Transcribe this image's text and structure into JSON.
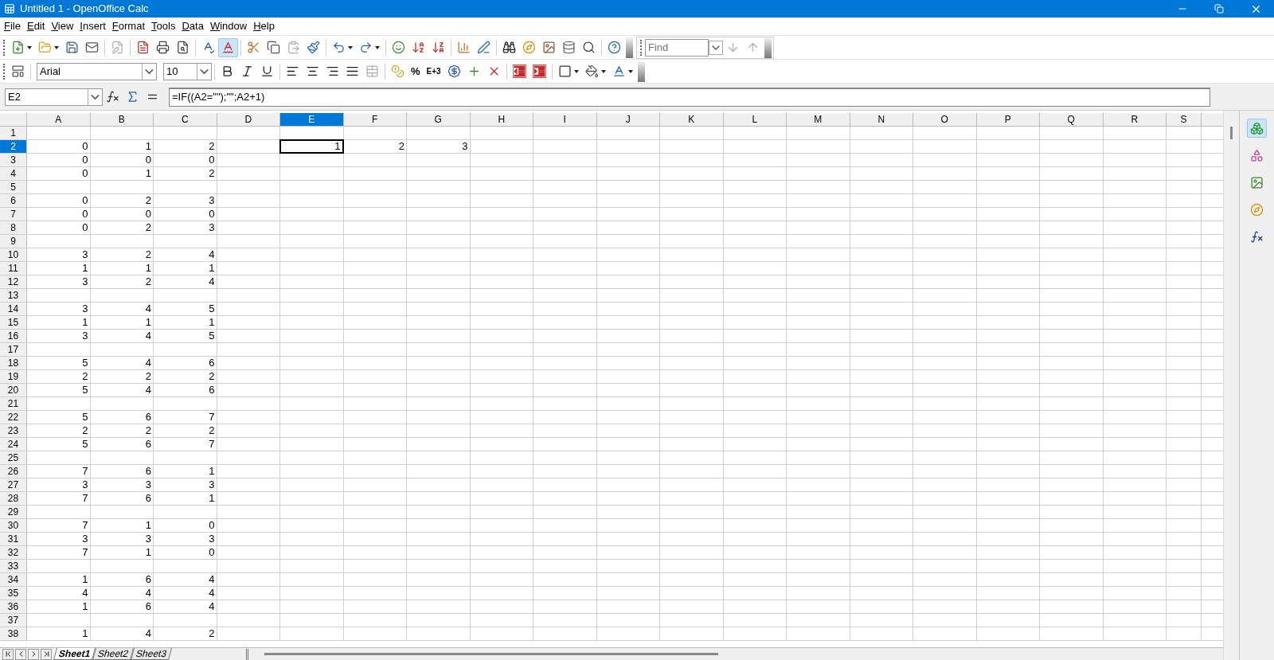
{
  "window": {
    "title": "Untitled 1 - OpenOffice Calc"
  },
  "menu": [
    "File",
    "Edit",
    "View",
    "Insert",
    "Format",
    "Tools",
    "Data",
    "Window",
    "Help"
  ],
  "toolbar": {
    "autospell_on": true
  },
  "find": {
    "placeholder": "Find"
  },
  "format_bar": {
    "font": "Arial",
    "size": "10",
    "percent": "%",
    "exponent": "E+3"
  },
  "formula_bar": {
    "cell_ref": "E2",
    "formula": "=IF((A2=\"\");\"\";A2+1)"
  },
  "columns": [
    {
      "label": "A",
      "selected": false
    },
    {
      "label": "B",
      "selected": false
    },
    {
      "label": "C",
      "selected": false
    },
    {
      "label": "D",
      "selected": false
    },
    {
      "label": "E",
      "selected": true
    },
    {
      "label": "F",
      "selected": false
    },
    {
      "label": "G",
      "selected": false
    },
    {
      "label": "H",
      "selected": false
    },
    {
      "label": "I",
      "selected": false
    },
    {
      "label": "J",
      "selected": false
    },
    {
      "label": "K",
      "selected": false
    },
    {
      "label": "L",
      "selected": false
    },
    {
      "label": "M",
      "selected": false
    },
    {
      "label": "N",
      "selected": false
    },
    {
      "label": "O",
      "selected": false
    },
    {
      "label": "P",
      "selected": false
    },
    {
      "label": "Q",
      "selected": false
    },
    {
      "label": "R",
      "selected": false
    },
    {
      "label": "S",
      "selected": false
    }
  ],
  "rows": [
    {
      "number": "1",
      "selected": false,
      "cells": []
    },
    {
      "number": "2",
      "selected": true,
      "cells": [
        "0",
        "1",
        "2",
        null,
        "1",
        "2",
        "3"
      ]
    },
    {
      "number": "3",
      "selected": false,
      "cells": [
        "0",
        "0",
        "0"
      ]
    },
    {
      "number": "4",
      "selected": false,
      "cells": [
        "0",
        "1",
        "2"
      ]
    },
    {
      "number": "5",
      "selected": false,
      "cells": []
    },
    {
      "number": "6",
      "selected": false,
      "cells": [
        "0",
        "2",
        "3"
      ]
    },
    {
      "number": "7",
      "selected": false,
      "cells": [
        "0",
        "0",
        "0"
      ]
    },
    {
      "number": "8",
      "selected": false,
      "cells": [
        "0",
        "2",
        "3"
      ]
    },
    {
      "number": "9",
      "selected": false,
      "cells": []
    },
    {
      "number": "10",
      "selected": false,
      "cells": [
        "3",
        "2",
        "4"
      ]
    },
    {
      "number": "11",
      "selected": false,
      "cells": [
        "1",
        "1",
        "1"
      ]
    },
    {
      "number": "12",
      "selected": false,
      "cells": [
        "3",
        "2",
        "4"
      ]
    },
    {
      "number": "13",
      "selected": false,
      "cells": []
    },
    {
      "number": "14",
      "selected": false,
      "cells": [
        "3",
        "4",
        "5"
      ]
    },
    {
      "number": "15",
      "selected": false,
      "cells": [
        "1",
        "1",
        "1"
      ]
    },
    {
      "number": "16",
      "selected": false,
      "cells": [
        "3",
        "4",
        "5"
      ]
    },
    {
      "number": "17",
      "selected": false,
      "cells": []
    },
    {
      "number": "18",
      "selected": false,
      "cells": [
        "5",
        "4",
        "6"
      ]
    },
    {
      "number": "19",
      "selected": false,
      "cells": [
        "2",
        "2",
        "2"
      ]
    },
    {
      "number": "20",
      "selected": false,
      "cells": [
        "5",
        "4",
        "6"
      ]
    },
    {
      "number": "21",
      "selected": false,
      "cells": []
    },
    {
      "number": "22",
      "selected": false,
      "cells": [
        "5",
        "6",
        "7"
      ]
    },
    {
      "number": "23",
      "selected": false,
      "cells": [
        "2",
        "2",
        "2"
      ]
    },
    {
      "number": "24",
      "selected": false,
      "cells": [
        "5",
        "6",
        "7"
      ]
    },
    {
      "number": "25",
      "selected": false,
      "cells": []
    },
    {
      "number": "26",
      "selected": false,
      "cells": [
        "7",
        "6",
        "1"
      ]
    },
    {
      "number": "27",
      "selected": false,
      "cells": [
        "3",
        "3",
        "3"
      ]
    },
    {
      "number": "28",
      "selected": false,
      "cells": [
        "7",
        "6",
        "1"
      ]
    },
    {
      "number": "29",
      "selected": false,
      "cells": []
    },
    {
      "number": "30",
      "selected": false,
      "cells": [
        "7",
        "1",
        "0"
      ]
    },
    {
      "number": "31",
      "selected": false,
      "cells": [
        "3",
        "3",
        "3"
      ]
    },
    {
      "number": "32",
      "selected": false,
      "cells": [
        "7",
        "1",
        "0"
      ]
    },
    {
      "number": "33",
      "selected": false,
      "cells": []
    },
    {
      "number": "34",
      "selected": false,
      "cells": [
        "1",
        "6",
        "4"
      ]
    },
    {
      "number": "35",
      "selected": false,
      "cells": [
        "4",
        "4",
        "4"
      ]
    },
    {
      "number": "36",
      "selected": false,
      "cells": [
        "1",
        "6",
        "4"
      ]
    },
    {
      "number": "37",
      "selected": false,
      "cells": []
    },
    {
      "number": "38",
      "selected": false,
      "cells": [
        "1",
        "4",
        "2"
      ]
    }
  ],
  "sheets": [
    {
      "label": "Sheet1",
      "selected": true
    },
    {
      "label": "Sheet2",
      "selected": false
    },
    {
      "label": "Sheet3",
      "selected": false
    }
  ]
}
